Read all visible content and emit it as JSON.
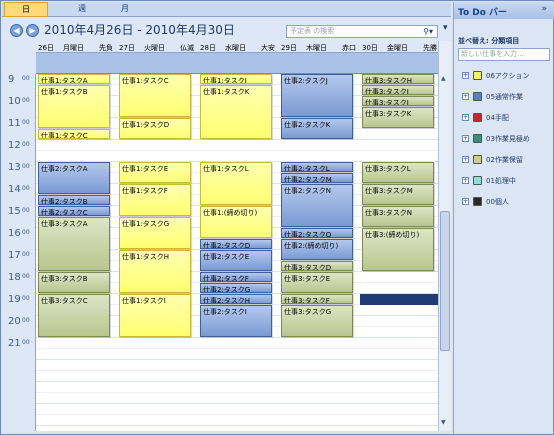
{
  "tabs": [
    "日",
    "週",
    "月"
  ],
  "header": {
    "range": "2010年4月26日 - 2010年4月30日",
    "search_placeholder": "予定表 の検索"
  },
  "days": [
    {
      "date": "26日",
      "weekday": "月曜日",
      "note": "先負"
    },
    {
      "date": "27日",
      "weekday": "火曜日",
      "note": "仏滅"
    },
    {
      "date": "28日",
      "weekday": "水曜日",
      "note": "大安"
    },
    {
      "date": "29日",
      "weekday": "木曜日",
      "note": "赤口"
    },
    {
      "date": "30日",
      "weekday": "金曜日",
      "note": "先勝"
    }
  ],
  "hours": [
    "9",
    "10",
    "11",
    "12",
    "13",
    "14",
    "15",
    "16",
    "17",
    "18",
    "19",
    "20",
    "21"
  ],
  "minute_label": "00",
  "events": [
    {
      "day": 0,
      "start": 9.0,
      "end": 9.5,
      "color": "yellow",
      "title": "仕事1:タスクA"
    },
    {
      "day": 0,
      "start": 9.5,
      "end": 11.5,
      "color": "yellow",
      "title": "仕事1:タスクB"
    },
    {
      "day": 0,
      "start": 11.5,
      "end": 12.0,
      "color": "yellow",
      "title": "仕事1:タスクC"
    },
    {
      "day": 0,
      "start": 13.0,
      "end": 14.5,
      "color": "blue",
      "title": "仕事2:タスクA"
    },
    {
      "day": 0,
      "start": 14.5,
      "end": 15.0,
      "color": "blue",
      "title": "仕事2:タスクB"
    },
    {
      "day": 0,
      "start": 15.0,
      "end": 15.5,
      "color": "blue",
      "title": "仕事2:タスクC"
    },
    {
      "day": 0,
      "start": 15.5,
      "end": 18.0,
      "color": "olive",
      "title": "仕事3:タスクA"
    },
    {
      "day": 0,
      "start": 18.0,
      "end": 19.0,
      "color": "olive",
      "title": "仕事3:タスクB"
    },
    {
      "day": 0,
      "start": 19.0,
      "end": 21.0,
      "color": "olive",
      "title": "仕事3:タスクC"
    },
    {
      "day": 1,
      "start": 9.0,
      "end": 11.0,
      "color": "yellow",
      "title": "仕事1:タスクC"
    },
    {
      "day": 1,
      "start": 11.0,
      "end": 12.0,
      "color": "yellow",
      "title": "仕事1:タスクD"
    },
    {
      "day": 1,
      "start": 13.0,
      "end": 14.0,
      "color": "yellow",
      "title": "仕事1:タスクE"
    },
    {
      "day": 1,
      "start": 14.0,
      "end": 15.5,
      "color": "yellow",
      "title": "仕事1:タスクF"
    },
    {
      "day": 1,
      "start": 15.5,
      "end": 17.0,
      "color": "yellow",
      "title": "仕事1:タスクG"
    },
    {
      "day": 1,
      "start": 17.0,
      "end": 19.0,
      "color": "yellow",
      "title": "仕事1:タスクH"
    },
    {
      "day": 1,
      "start": 19.0,
      "end": 21.0,
      "color": "yellow",
      "title": "仕事1:タスクI"
    },
    {
      "day": 2,
      "start": 9.0,
      "end": 9.5,
      "color": "yellow",
      "title": "仕事1:タスクJ"
    },
    {
      "day": 2,
      "start": 9.5,
      "end": 12.0,
      "color": "yellow",
      "title": "仕事1:タスクK"
    },
    {
      "day": 2,
      "start": 13.0,
      "end": 15.0,
      "color": "yellow",
      "title": "仕事1:タスクL"
    },
    {
      "day": 2,
      "start": 15.0,
      "end": 16.5,
      "color": "yellow",
      "title": "仕事1:(締め切り)"
    },
    {
      "day": 2,
      "start": 16.5,
      "end": 17.0,
      "color": "blue",
      "title": "仕事2:タスクD"
    },
    {
      "day": 2,
      "start": 17.0,
      "end": 18.0,
      "color": "blue",
      "title": "仕事2:タスクE"
    },
    {
      "day": 2,
      "start": 18.0,
      "end": 18.5,
      "color": "blue",
      "title": "仕事2:タスクF"
    },
    {
      "day": 2,
      "start": 18.5,
      "end": 19.0,
      "color": "blue",
      "title": "仕事2:タスクG"
    },
    {
      "day": 2,
      "start": 19.0,
      "end": 19.5,
      "color": "blue",
      "title": "仕事2:タスクH"
    },
    {
      "day": 2,
      "start": 19.5,
      "end": 21.0,
      "color": "blue",
      "title": "仕事2:タスクI"
    },
    {
      "day": 3,
      "start": 9.0,
      "end": 11.0,
      "color": "blue",
      "title": "仕事2:タスクJ"
    },
    {
      "day": 3,
      "start": 11.0,
      "end": 12.0,
      "color": "blue",
      "title": "仕事2:タスクK"
    },
    {
      "day": 3,
      "start": 13.0,
      "end": 13.5,
      "color": "blue",
      "title": "仕事2:タスクL"
    },
    {
      "day": 3,
      "start": 13.5,
      "end": 14.0,
      "color": "blue",
      "title": "仕事2:タスクM"
    },
    {
      "day": 3,
      "start": 14.0,
      "end": 16.0,
      "color": "blue",
      "title": "仕事2:タスクN"
    },
    {
      "day": 3,
      "start": 16.0,
      "end": 16.5,
      "color": "blue",
      "title": "仕事2:タスクO"
    },
    {
      "day": 3,
      "start": 16.5,
      "end": 17.5,
      "color": "blue",
      "title": "仕事2:(締め切り)"
    },
    {
      "day": 3,
      "start": 17.5,
      "end": 18.0,
      "color": "olive",
      "title": "仕事3:タスクD"
    },
    {
      "day": 3,
      "start": 18.0,
      "end": 19.0,
      "color": "olive",
      "title": "仕事3:タスクE"
    },
    {
      "day": 3,
      "start": 19.0,
      "end": 19.5,
      "color": "olive",
      "title": "仕事3:タスクF"
    },
    {
      "day": 3,
      "start": 19.5,
      "end": 21.0,
      "color": "olive",
      "title": "仕事3:タスクG"
    },
    {
      "day": 4,
      "start": 9.0,
      "end": 9.5,
      "color": "olive",
      "title": "仕事3:タスクH"
    },
    {
      "day": 4,
      "start": 9.5,
      "end": 10.0,
      "color": "olive",
      "title": "仕事3:タスクI"
    },
    {
      "day": 4,
      "start": 10.0,
      "end": 10.5,
      "color": "olive",
      "title": "仕事3:タスクJ"
    },
    {
      "day": 4,
      "start": 10.5,
      "end": 11.5,
      "color": "olive",
      "title": "仕事3:タスクK"
    },
    {
      "day": 4,
      "start": 13.0,
      "end": 14.0,
      "color": "olive",
      "title": "仕事3:タスクL"
    },
    {
      "day": 4,
      "start": 14.0,
      "end": 15.0,
      "color": "olive",
      "title": "仕事3:タスクM"
    },
    {
      "day": 4,
      "start": 15.0,
      "end": 16.0,
      "color": "olive",
      "title": "仕事3:タスクN"
    },
    {
      "day": 4,
      "start": 16.0,
      "end": 18.0,
      "color": "olive",
      "title": "仕事3:(締め切り)"
    }
  ],
  "todo": {
    "title": "To Do バー",
    "sort_label": "並べ替え: 分類項目",
    "new_task_placeholder": "新しい仕事を入力...",
    "categories": [
      {
        "label": "06アクション",
        "color": "#f3f07a"
      },
      {
        "label": "05通常作業",
        "color": "#5b7ec9"
      },
      {
        "label": "04手配",
        "color": "#c4262d"
      },
      {
        "label": "03作業見極め",
        "color": "#3e8e73"
      },
      {
        "label": "02作業保留",
        "color": "#c9cf91"
      },
      {
        "label": "01処理中",
        "color": "#8fe0d4"
      },
      {
        "label": "00個人",
        "color": "#2a2a2a"
      }
    ]
  }
}
